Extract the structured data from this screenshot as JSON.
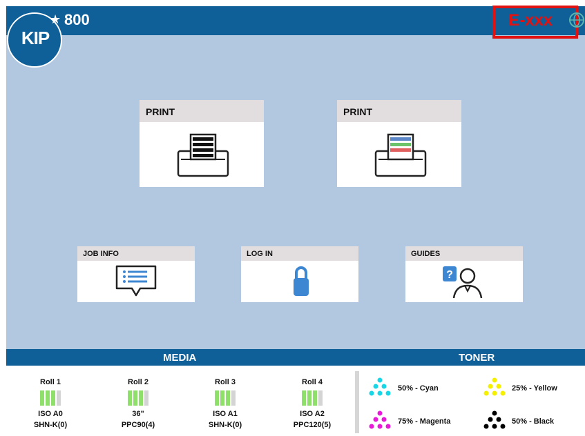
{
  "header": {
    "logo_text": "KIP",
    "model": "800",
    "error_code": "E-xxx"
  },
  "tiles": [
    {
      "label": "PRINT",
      "icon": "mono-printer-icon"
    },
    {
      "label": "PRINT",
      "icon": "color-printer-icon"
    },
    {
      "label": "JOB INFO",
      "icon": "job-info-icon"
    },
    {
      "label": "LOG IN",
      "icon": "lock-icon"
    },
    {
      "label": "GUIDES",
      "icon": "guides-icon"
    }
  ],
  "media": {
    "title": "MEDIA",
    "rolls": [
      {
        "name": "Roll 1",
        "size": "ISO A0",
        "type": "SHN-K(0)",
        "level": 0.75
      },
      {
        "name": "Roll 2",
        "size": "36\"",
        "type": "PPC90(4)",
        "level": 0.75
      },
      {
        "name": "Roll 3",
        "size": "ISO A1",
        "type": "SHN-K(0)",
        "level": 0.75
      },
      {
        "name": "Roll 4",
        "size": "ISO A2",
        "type": "PPC120(5)",
        "level": 0.75
      }
    ]
  },
  "toner": {
    "title": "TONER",
    "items": [
      {
        "label": "50% - Cyan",
        "color": "#19d6e6"
      },
      {
        "label": "25% - Yellow",
        "color": "#f4f000"
      },
      {
        "label": "75% - Magenta",
        "color": "#e81ad8"
      },
      {
        "label": "50% - Black",
        "color": "#000000"
      }
    ]
  }
}
